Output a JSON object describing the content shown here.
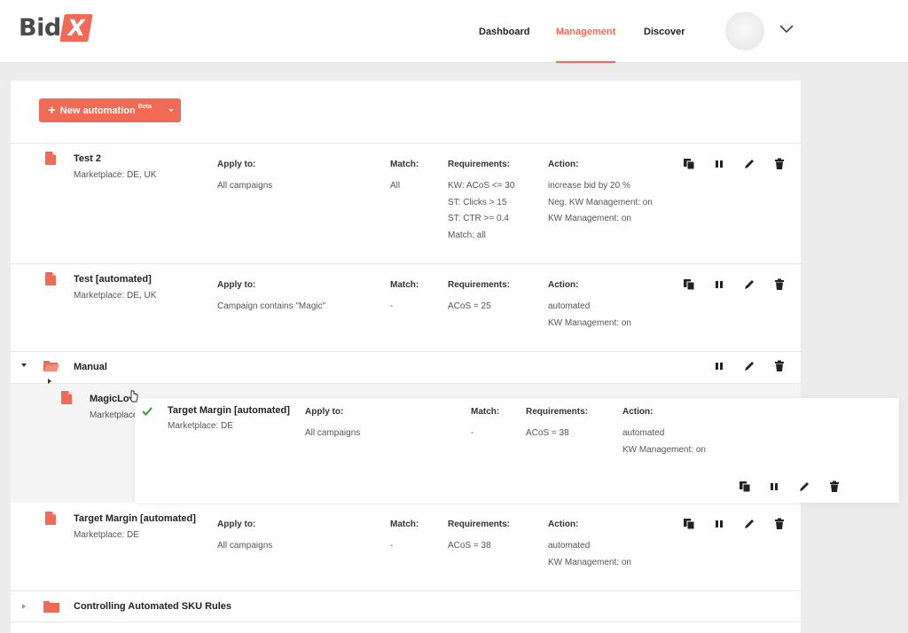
{
  "brand": {
    "name": "Bid",
    "mark": "X",
    "accent": "#f16a55"
  },
  "nav": {
    "dashboard": "Dashboard",
    "management": "Management",
    "discover": "Discover",
    "active": "Management"
  },
  "toolbar": {
    "new_label": "New automation",
    "beta": "Beta"
  },
  "columns": {
    "apply": "Apply to:",
    "match": "Match:",
    "requirements": "Requirements:",
    "action": "Action:"
  },
  "rules": [
    {
      "name": "Test 2",
      "marketplace": "Marketplace: DE, UK",
      "apply": "All campaigns",
      "match": "All",
      "requirements": [
        "KW: ACoS <= 30",
        "ST: Clicks > 15",
        "ST: CTR >= 0.4",
        "Match: all"
      ],
      "actions": [
        "increase bid by 20 %",
        "Neg. KW Management: on",
        "KW Management: on"
      ]
    },
    {
      "name": "Test [automated]",
      "marketplace": "Marketplace: DE, UK",
      "apply": "Campaign contains \"Magic\"",
      "match": "-",
      "requirements": [
        "ACoS = 25"
      ],
      "actions": [
        "automated",
        "KW Management: on"
      ]
    },
    {
      "name": "Target Margin [automated]",
      "marketplace": "Marketplace: DE",
      "apply": "All campaigns",
      "match": "-",
      "requirements": [
        "ACoS = 38"
      ],
      "actions": [
        "automated",
        "KW Management: on"
      ]
    }
  ],
  "folders": [
    {
      "name": "Manual",
      "state": "expanded"
    },
    {
      "name": "Controlling Automated SKU Rules",
      "state": "collapsed"
    }
  ],
  "partial_rule": {
    "name": "MagicLo",
    "marketplace": "Marketplace"
  },
  "drag_ghost": {
    "name": "Target Margin [automated]",
    "marketplace": "Marketplace: DE",
    "apply": "All campaigns",
    "match": "-",
    "requirements": [
      "ACoS = 38"
    ],
    "actions": [
      "automated",
      "KW Management: on"
    ]
  },
  "icons": [
    "copy-icon",
    "pause-icon",
    "edit-icon",
    "delete-icon",
    "file-icon",
    "folder-icon",
    "check-icon",
    "chevron-down-icon"
  ]
}
